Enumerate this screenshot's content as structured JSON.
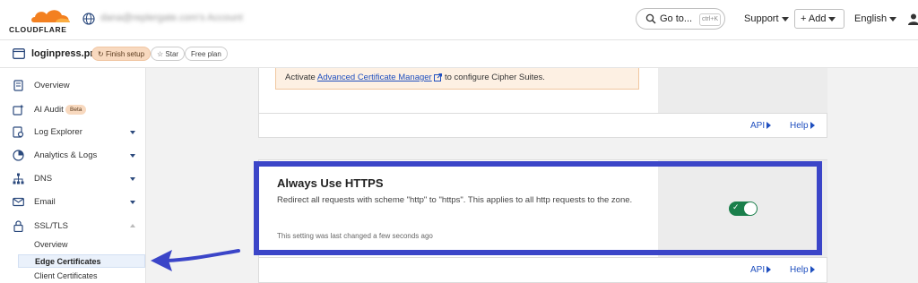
{
  "topbar": {
    "brand": "CLOUDFLARE",
    "account": "dana@replergate.com's Account",
    "goto_label": "Go to...",
    "goto_shortcut": "ctrl+K",
    "support_label": "Support",
    "add_label": "+ Add",
    "language_label": "English"
  },
  "zone": {
    "name": "loginpress.pro",
    "finish_setup": "Finish setup",
    "star": "Star",
    "plan": "Free plan"
  },
  "sidebar": {
    "items": [
      {
        "label": "Overview",
        "icon": "document-icon"
      },
      {
        "label": "AI Audit",
        "icon": "ai-audit-icon",
        "badge": "Beta"
      },
      {
        "label": "Log Explorer",
        "icon": "log-explorer-icon"
      },
      {
        "label": "Analytics & Logs",
        "icon": "analytics-icon"
      },
      {
        "label": "DNS",
        "icon": "dns-icon"
      },
      {
        "label": "Email",
        "icon": "email-icon"
      },
      {
        "label": "SSL/TLS",
        "icon": "lock-icon"
      }
    ],
    "ssl_sub": [
      "Overview",
      "Edge Certificates",
      "Client Certificates"
    ]
  },
  "cipher_card": {
    "notice_prefix": "Activate ",
    "notice_link": "Advanced Certificate Manager",
    "notice_suffix": " to configure Cipher Suites.",
    "api": "API",
    "help": "Help"
  },
  "https_card": {
    "title": "Always Use HTTPS",
    "description": "Redirect all requests with scheme \"http\" to \"https\". This applies to all http requests to the zone.",
    "changed": "This setting was last changed a few seconds ago",
    "enabled": true,
    "api": "API",
    "help": "Help"
  },
  "colors": {
    "highlight": "#3b45c8",
    "toggle_on": "#1a7f4b",
    "link": "#1f4fbf",
    "brand_orange": "#f38020"
  }
}
